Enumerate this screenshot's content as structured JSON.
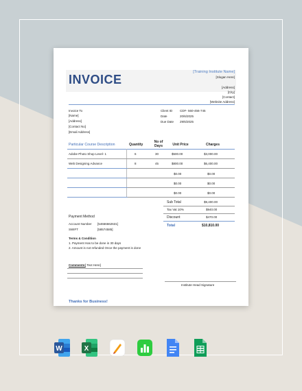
{
  "invoice": {
    "title": "INVOICE",
    "institute_name": "[Training Institute Name]",
    "slogan": "[Slogan Here]",
    "address": "[Address]",
    "city": "[City]",
    "contact": "[Contact]",
    "website": "[Website Address]",
    "invoice_to_label": "Invoice To",
    "invoice_to": [
      "[Name]",
      "[Address]",
      "[Contact No]",
      "[Email Address]"
    ],
    "meta": [
      {
        "label": "Client ID",
        "value": "CDF- 560-456-745"
      },
      {
        "label": "Date",
        "value": "20/6/2025"
      },
      {
        "label": "Due Date",
        "value": "29/6/2025"
      }
    ],
    "table": {
      "headers": [
        "Particular Course Description",
        "Quantity",
        "No of Days",
        "Unit Price",
        "Charges"
      ],
      "rows": [
        [
          "Adobe Photo Shop Level- 1",
          "6",
          "30",
          "$500.00",
          "$3,000.00"
        ],
        [
          "Web Designing Advance",
          "8",
          "45",
          "$800.00",
          "$6,400.00"
        ],
        [
          "",
          "",
          "",
          "$0.00",
          "$0.00"
        ],
        [
          "",
          "",
          "",
          "$0.00",
          "$0.00"
        ],
        [
          "",
          "",
          "",
          "$0.00",
          "$0.00"
        ]
      ]
    },
    "totals": [
      {
        "label": "Sub Total",
        "value": "$9,400.00"
      },
      {
        "label": "Tax Vat 10%",
        "value": "$940.00"
      },
      {
        "label": "Discount",
        "value": "$470.00"
      },
      {
        "label": "Total",
        "value": "$10,810.00"
      }
    ],
    "payment_method_label": "Payment Method",
    "payment": [
      {
        "label": "Account Number",
        "value": "[54666662631]"
      },
      {
        "label": "SWIFT",
        "value": "[58574585]"
      }
    ],
    "terms_label": "Terms & Condition",
    "terms": [
      "1. Payment Has to be done in 30 days",
      "2. Amount is not refunded Once the payment is done"
    ],
    "comments_label": "Comments:",
    "comments_value": "[ Text Here]",
    "signature_label": "Institute Head Signature",
    "thanks": "Thanks for Business!"
  },
  "app_icons": [
    "word-icon",
    "excel-icon",
    "pages-icon",
    "numbers-icon",
    "google-docs-icon",
    "google-sheets-icon"
  ],
  "colors": {
    "title_blue": "#2f4d86",
    "accent_blue": "#3d6bb5",
    "word": "#2b579a",
    "excel": "#217346",
    "pages": "#f39c12",
    "numbers": "#2ecc40",
    "gdocs": "#4285f4",
    "gsheets": "#0f9d58"
  }
}
